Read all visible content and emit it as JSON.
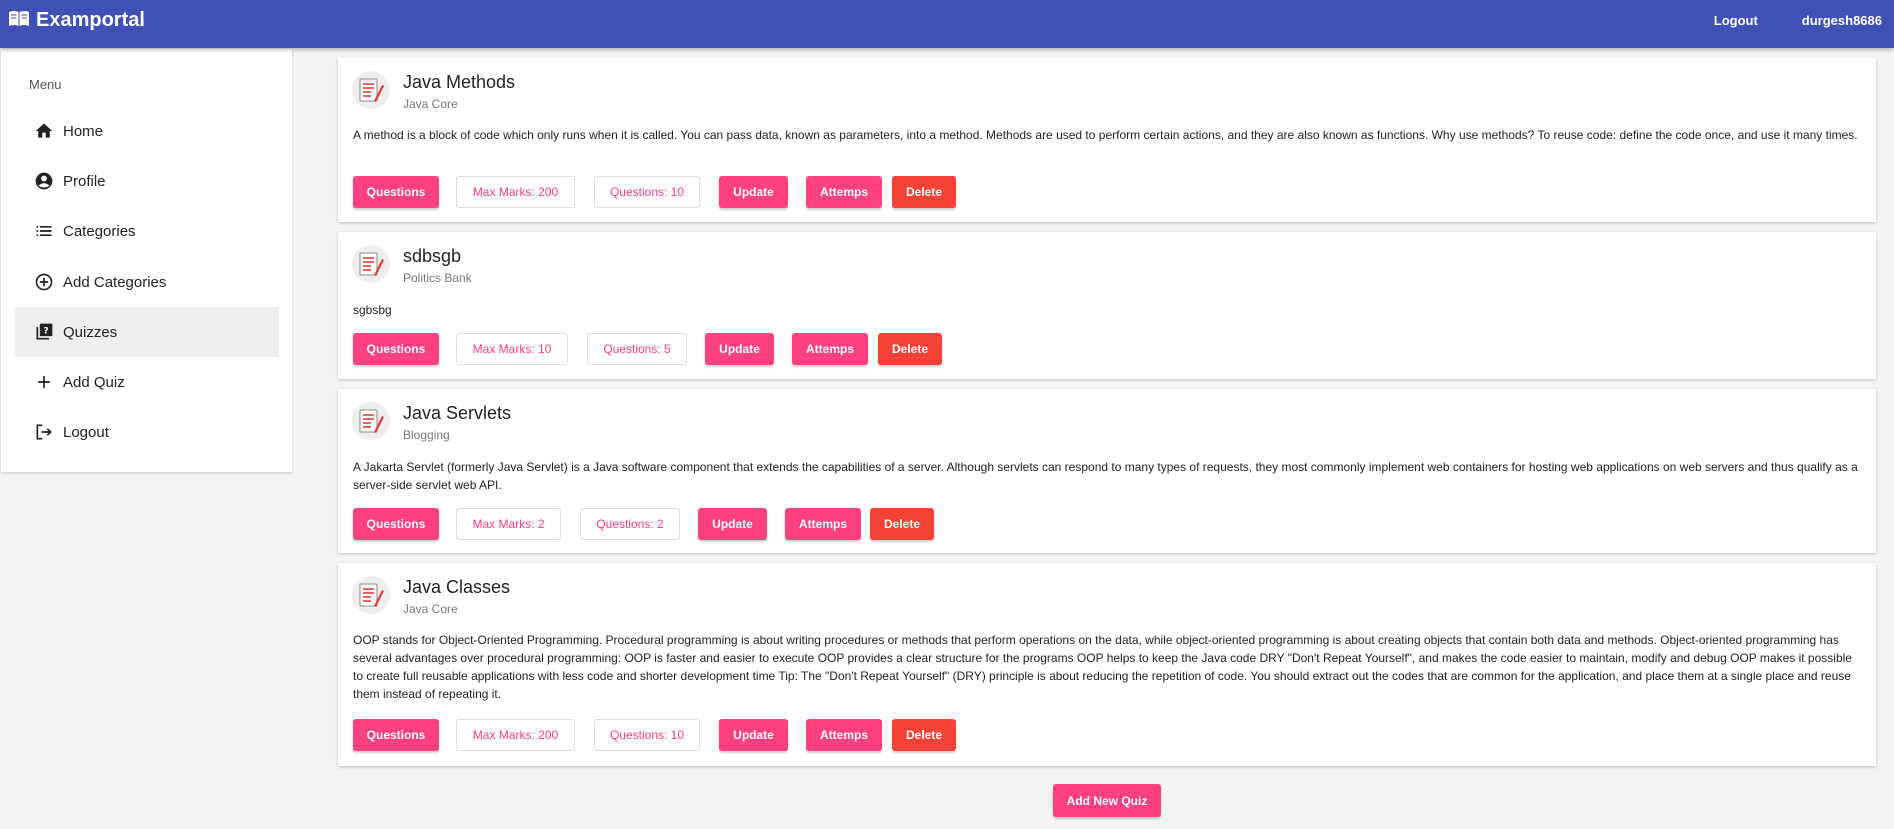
{
  "app": {
    "title": "Examportal"
  },
  "topbar": {
    "logout_label": "Logout",
    "username": "durgesh8686"
  },
  "sidebar": {
    "title": "Menu",
    "items": [
      {
        "label": "Home",
        "icon": "home-icon"
      },
      {
        "label": "Profile",
        "icon": "account-circle-icon"
      },
      {
        "label": "Categories",
        "icon": "list-icon"
      },
      {
        "label": "Add Categories",
        "icon": "add-circle-icon"
      },
      {
        "label": "Quizzes",
        "icon": "quiz-icon",
        "active": true
      },
      {
        "label": "Add Quiz",
        "icon": "plus-icon"
      },
      {
        "label": "Logout",
        "icon": "exit-icon"
      }
    ]
  },
  "quizzes": [
    {
      "title": "Java Methods",
      "category": "Java Core",
      "description": "A method is a block of code which only runs when it is called. You can pass data, known as parameters, into a method. Methods are used to perform certain actions, and they are also known as functions. Why use methods? To reuse code: define the code once, and use it many times.",
      "questions_label": "Questions",
      "max_marks": "Max Marks: 200",
      "question_count": "Questions: 10",
      "update_label": "Update",
      "attempts_label": "Attemps",
      "delete_label": "Delete"
    },
    {
      "title": "sdbsgb",
      "category": "Politics Bank",
      "description": "sgbsbg",
      "questions_label": "Questions",
      "max_marks": "Max Marks: 10",
      "question_count": "Questions: 5",
      "update_label": "Update",
      "attempts_label": "Attemps",
      "delete_label": "Delete"
    },
    {
      "title": "Java Servlets",
      "category": "Blogging",
      "description": "A Jakarta Servlet (formerly Java Servlet) is a Java software component that extends the capabilities of a server. Although servlets can respond to many types of requests, they most commonly implement web containers for hosting web applications on web servers and thus qualify as a server-side servlet web API.",
      "questions_label": "Questions",
      "max_marks": "Max Marks: 2",
      "question_count": "Questions: 2",
      "update_label": "Update",
      "attempts_label": "Attemps",
      "delete_label": "Delete"
    },
    {
      "title": "Java Classes",
      "category": "Java Core",
      "description": "OOP stands for Object-Oriented Programming. Procedural programming is about writing procedures or methods that perform operations on the data, while object-oriented programming is about creating objects that contain both data and methods. Object-oriented programming has several advantages over procedural programming: OOP is faster and easier to execute OOP provides a clear structure for the programs OOP helps to keep the Java code DRY \"Don't Repeat Yourself\", and makes the code easier to maintain, modify and debug OOP makes it possible to create full reusable applications with less code and shorter development time Tip: The \"Don't Repeat Yourself\" (DRY) principle is about reducing the repetition of code. You should extract out the codes that are common for the application, and place them at a single place and reuse them instead of repeating it.",
      "questions_label": "Questions",
      "max_marks": "Max Marks: 200",
      "question_count": "Questions: 10",
      "update_label": "Update",
      "attempts_label": "Attemps",
      "delete_label": "Delete"
    }
  ],
  "footer": {
    "add_quiz_label": "Add New Quiz"
  },
  "colors": {
    "primary": "#3f51b5",
    "accent": "#ff4081",
    "warn": "#f44336"
  }
}
